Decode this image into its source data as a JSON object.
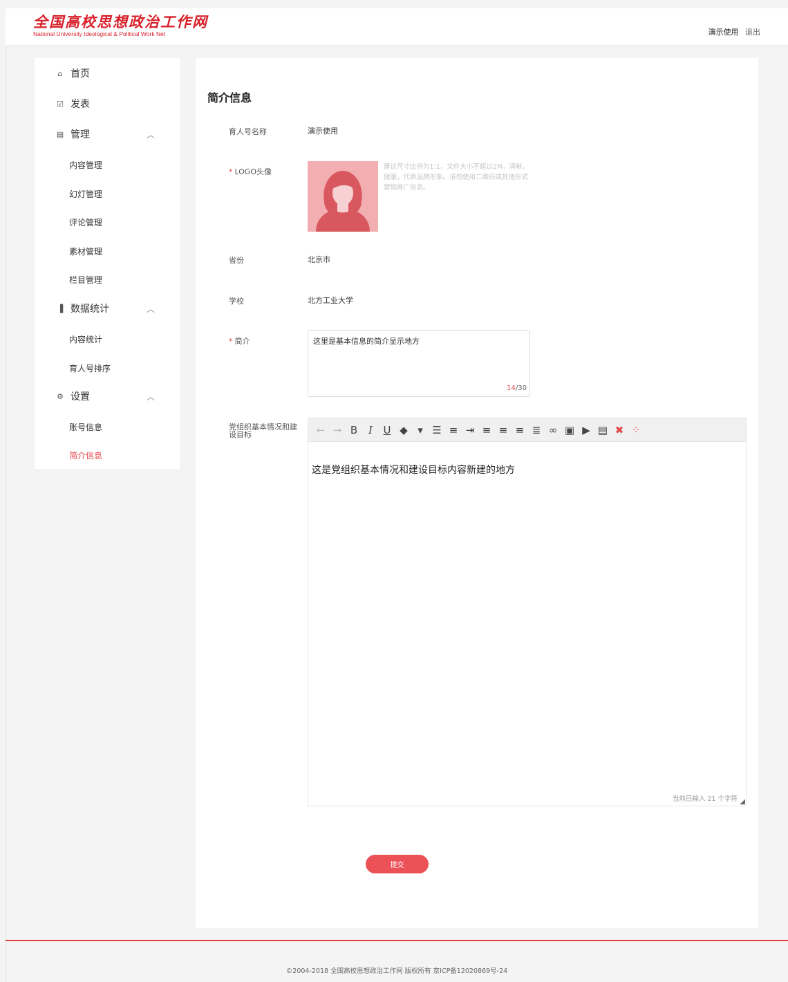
{
  "header": {
    "logo_cn": "全国高校思想政治工作网",
    "logo_en": "National University Ideological & Political Work Net",
    "user_name": "演示使用",
    "logout_label": "退出"
  },
  "sidebar": {
    "home": "首页",
    "publish": "发表",
    "manage": "管理",
    "manage_items": [
      "内容管理",
      "幻灯管理",
      "评论管理",
      "素材管理",
      "栏目管理"
    ],
    "stats": "数据统计",
    "stats_items": [
      "内容统计",
      "育人号排序"
    ],
    "settings": "设置",
    "settings_items": [
      "账号信息",
      "简介信息"
    ],
    "active_item": "简介信息"
  },
  "main": {
    "title": "简介信息",
    "name_label": "育人号名称",
    "name_value": "演示使用",
    "logo_label": "LOGO头像",
    "logo_hint": "建议尺寸比例为1:1，文件大小不超过2M，清晰，健康，代表品牌形象。请勿使用二维码或其他形式营销推广信息。",
    "province_label": "省份",
    "province_value": "北京市",
    "school_label": "学校",
    "school_value": "北方工业大学",
    "intro_label": "简介",
    "intro_value": "这里是基本信息的简介显示地方",
    "intro_count_current": "14",
    "intro_count_max": "/30",
    "party_label": "党组织基本情况和建设目标",
    "editor_content": "这是党组织基本情况和建设目标内容新建的地方",
    "editor_count": "当前已输入 21 个字符",
    "submit_label": "提交"
  },
  "footer": {
    "copyright": "©2004-2018 全国高校思想政治工作网 版权所有 京ICP备12020869号-24"
  },
  "colors": {
    "accent": "#e5484d",
    "brand": "#d8202a",
    "avatar_bg": "#f2aeb0"
  }
}
